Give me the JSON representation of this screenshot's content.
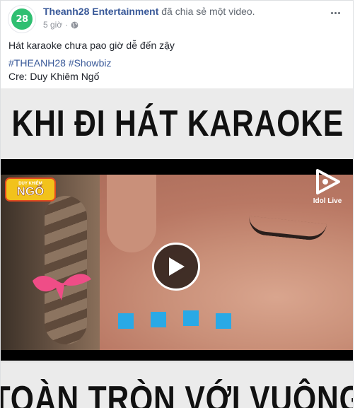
{
  "post": {
    "avatar_text": "28",
    "page_name": "Theanh28 Entertainment",
    "action": "đã chia sẻ một video.",
    "time": "5 giờ",
    "separator": "·",
    "caption": "Hát karaoke chưa pao giờ dễ đến zậy",
    "hashtags": [
      "#THEANH28",
      "#Showbiz"
    ],
    "credit": "Cre: Duy Khiêm Ngố"
  },
  "video": {
    "title_top": "KHI ĐI HÁT KARAOKE",
    "title_bottom": "TOÀN TRÒN VỚI VUÔNG",
    "brand_small": "DUY KHIÊM",
    "brand_big": "NGỐ",
    "watermark": "Idol Live"
  },
  "colors": {
    "link": "#385898",
    "loader": "#29a9e6",
    "avatar": "#2fbf71"
  },
  "icons": [
    "globe-icon",
    "more-options-icon",
    "play-icon",
    "idol-live-icon"
  ]
}
